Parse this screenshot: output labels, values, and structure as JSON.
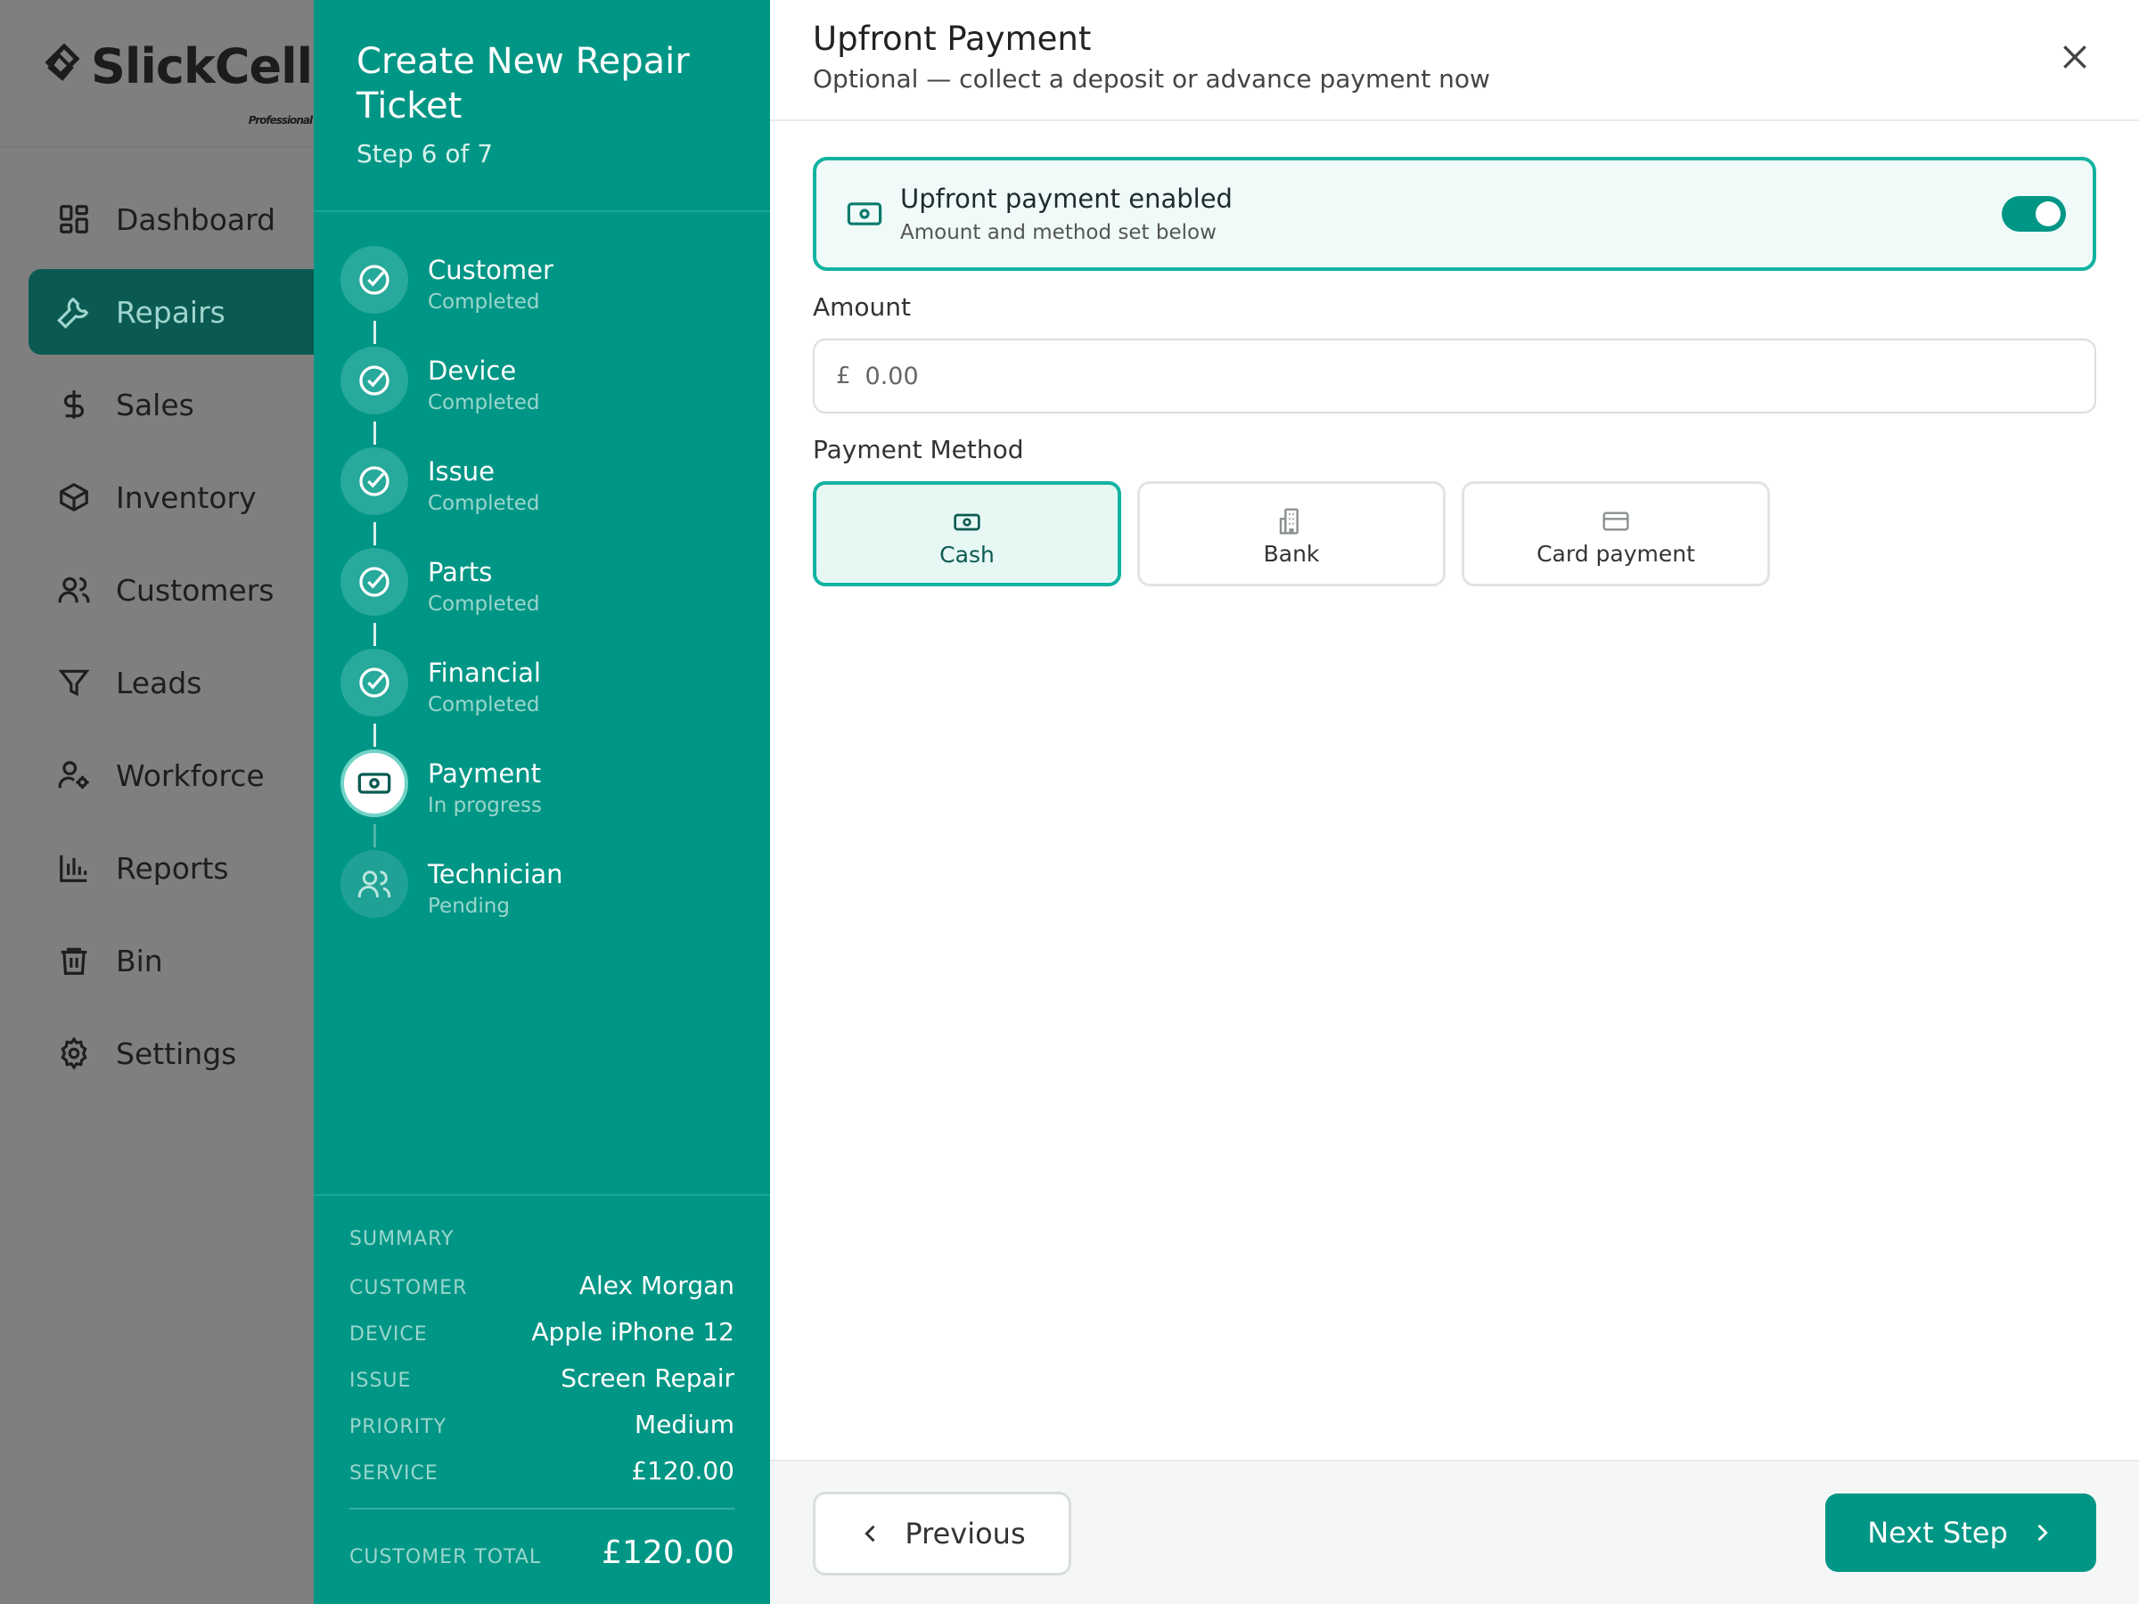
{
  "app": {
    "brand": "SlickCell",
    "brand_sub": "Professional",
    "nav": [
      {
        "label": "Dashboard",
        "icon": "dashboard-icon",
        "active": false
      },
      {
        "label": "Repairs",
        "icon": "wrench-icon",
        "active": true
      },
      {
        "label": "Sales",
        "icon": "dollar-icon",
        "active": false
      },
      {
        "label": "Inventory",
        "icon": "box-icon",
        "active": false
      },
      {
        "label": "Customers",
        "icon": "users-icon",
        "active": false
      },
      {
        "label": "Leads",
        "icon": "funnel-icon",
        "active": false
      },
      {
        "label": "Workforce",
        "icon": "user-cog-icon",
        "active": false
      },
      {
        "label": "Reports",
        "icon": "bar-chart-icon",
        "active": false
      },
      {
        "label": "Bin",
        "icon": "trash-icon",
        "active": false
      },
      {
        "label": "Settings",
        "icon": "gear-icon",
        "active": false
      }
    ]
  },
  "stepper": {
    "title": "Create New Repair Ticket",
    "step_text": "Step 6 of 7",
    "steps": [
      {
        "name": "Customer",
        "status": "Completed"
      },
      {
        "name": "Device",
        "status": "Completed"
      },
      {
        "name": "Issue",
        "status": "Completed"
      },
      {
        "name": "Parts",
        "status": "Completed"
      },
      {
        "name": "Financial",
        "status": "Completed"
      },
      {
        "name": "Payment",
        "status": "In progress"
      },
      {
        "name": "Technician",
        "status": "Pending"
      }
    ],
    "summary": {
      "heading": "SUMMARY",
      "rows": [
        {
          "key": "CUSTOMER",
          "value": "Alex Morgan"
        },
        {
          "key": "DEVICE",
          "value": "Apple iPhone 12"
        },
        {
          "key": "ISSUE",
          "value": "Screen Repair"
        },
        {
          "key": "PRIORITY",
          "value": "Medium"
        },
        {
          "key": "SERVICE",
          "value": "£120.00"
        }
      ],
      "total_key": "CUSTOMER TOTAL",
      "total_value": "£120.00"
    }
  },
  "modal": {
    "title": "Upfront Payment",
    "subtitle": "Optional — collect a deposit or advance payment now",
    "toggle_card": {
      "title": "Upfront payment enabled",
      "subtitle": "Amount and method set below",
      "enabled": true
    },
    "amount": {
      "label": "Amount",
      "currency": "£",
      "placeholder": "0.00",
      "value": ""
    },
    "payment_method": {
      "label": "Payment Method",
      "options": [
        {
          "label": "Cash",
          "icon": "cash-icon",
          "selected": true
        },
        {
          "label": "Bank",
          "icon": "bank-icon",
          "selected": false
        },
        {
          "label": "Card payment",
          "icon": "card-icon",
          "selected": false
        }
      ]
    },
    "footer": {
      "previous_label": "Previous",
      "next_label": "Next Step"
    }
  },
  "colors": {
    "accent": "#009685",
    "accent_dark": "#0b5a52",
    "overlay": "#7f7f7f"
  }
}
